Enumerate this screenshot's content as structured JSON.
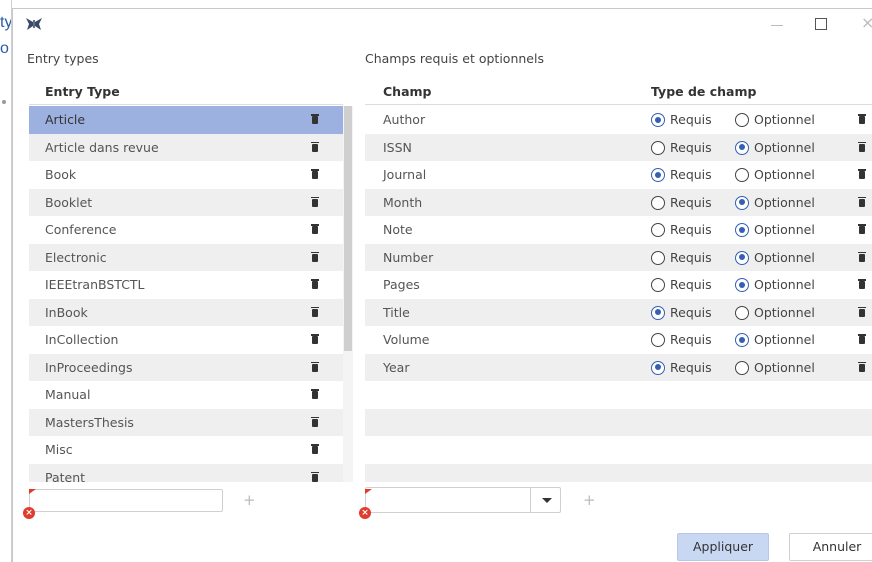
{
  "background_window": {
    "text_line1": "ty",
    "text_line2": "o"
  },
  "window": {
    "icon": "butterfly-logo-icon",
    "minimize": "minimize-icon",
    "maximize": "maximize-icon",
    "close": "×"
  },
  "left_panel": {
    "label": "Entry types",
    "column_header": "Entry Type",
    "items": [
      {
        "label": "Article",
        "selected": true
      },
      {
        "label": "Article dans revue"
      },
      {
        "label": "Book"
      },
      {
        "label": "Booklet"
      },
      {
        "label": "Conference"
      },
      {
        "label": "Electronic"
      },
      {
        "label": "IEEEtranBSTCTL"
      },
      {
        "label": "InBook"
      },
      {
        "label": "InCollection"
      },
      {
        "label": "InProceedings"
      },
      {
        "label": "Manual"
      },
      {
        "label": "MastersThesis"
      },
      {
        "label": "Misc"
      },
      {
        "label": "Patent"
      }
    ],
    "add_symbol": "+",
    "input_value": ""
  },
  "right_panel": {
    "label": "Champs requis et optionnels",
    "column_field": "Champ",
    "column_type": "Type de champ",
    "required_label": "Requis",
    "optional_label": "Optionnel",
    "rows": [
      {
        "field": "Author",
        "type": "required"
      },
      {
        "field": "ISSN",
        "type": "optional"
      },
      {
        "field": "Journal",
        "type": "required"
      },
      {
        "field": "Month",
        "type": "optional"
      },
      {
        "field": "Note",
        "type": "optional"
      },
      {
        "field": "Number",
        "type": "optional"
      },
      {
        "field": "Pages",
        "type": "optional"
      },
      {
        "field": "Title",
        "type": "required"
      },
      {
        "field": "Volume",
        "type": "optional"
      },
      {
        "field": "Year",
        "type": "required"
      }
    ],
    "add_symbol": "+",
    "combo_value": ""
  },
  "buttons": {
    "apply": "Appliquer",
    "cancel": "Annuler"
  },
  "colors": {
    "selected_row": "#9cb1e0",
    "radio_accent": "#355fb2",
    "error_red": "#e23b2e",
    "apply_bg": "#c9d8f2"
  }
}
